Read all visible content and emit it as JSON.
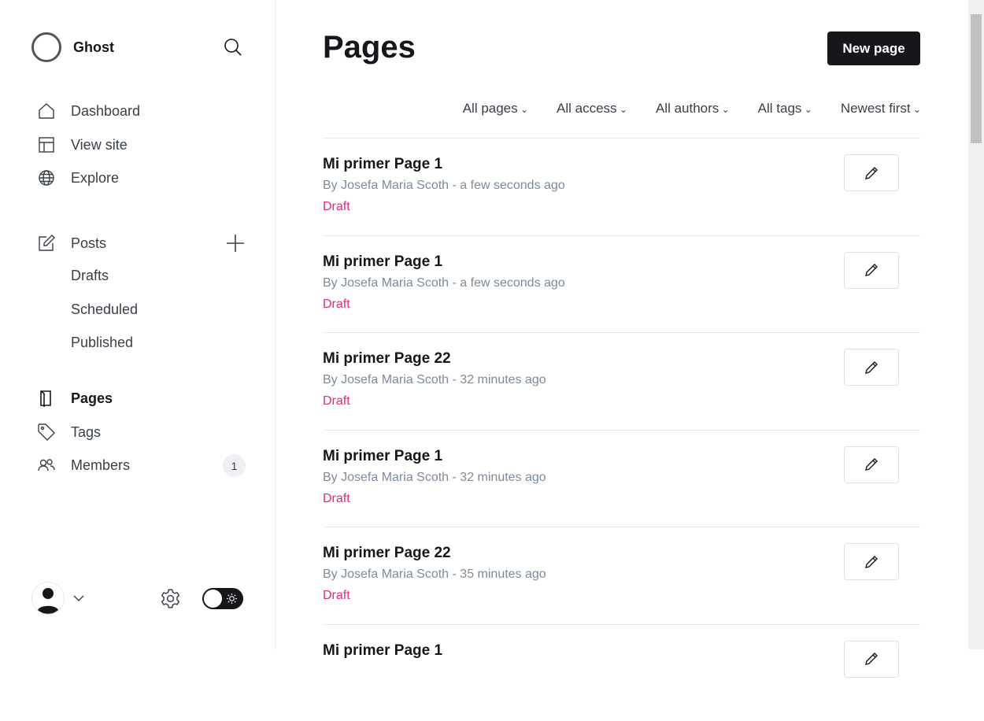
{
  "brand": {
    "name": "Ghost"
  },
  "nav": {
    "dashboard": "Dashboard",
    "view_site": "View site",
    "explore": "Explore",
    "posts": "Posts",
    "drafts": "Drafts",
    "scheduled": "Scheduled",
    "published": "Published",
    "pages": "Pages",
    "tags": "Tags",
    "members": "Members",
    "members_count": "1"
  },
  "header": {
    "title": "Pages",
    "new_button": "New page"
  },
  "filters": [
    "All pages",
    "All access",
    "All authors",
    "All tags",
    "Newest first"
  ],
  "rows": [
    {
      "title": "Mi primer Page 1",
      "meta": "By Josefa Maria Scoth - a few seconds ago",
      "status": "Draft"
    },
    {
      "title": "Mi primer Page 1",
      "meta": "By Josefa Maria Scoth - a few seconds ago",
      "status": "Draft"
    },
    {
      "title": "Mi primer Page 22",
      "meta": "By Josefa Maria Scoth - 32 minutes ago",
      "status": "Draft"
    },
    {
      "title": "Mi primer Page 1",
      "meta": "By Josefa Maria Scoth - 32 minutes ago",
      "status": "Draft"
    },
    {
      "title": "Mi primer Page 22",
      "meta": "By Josefa Maria Scoth - 35 minutes ago",
      "status": "Draft"
    },
    {
      "title": "Mi primer Page 1",
      "meta": "",
      "status": ""
    }
  ],
  "colors": {
    "accent": "#15171a",
    "draft": "#f0247a"
  }
}
